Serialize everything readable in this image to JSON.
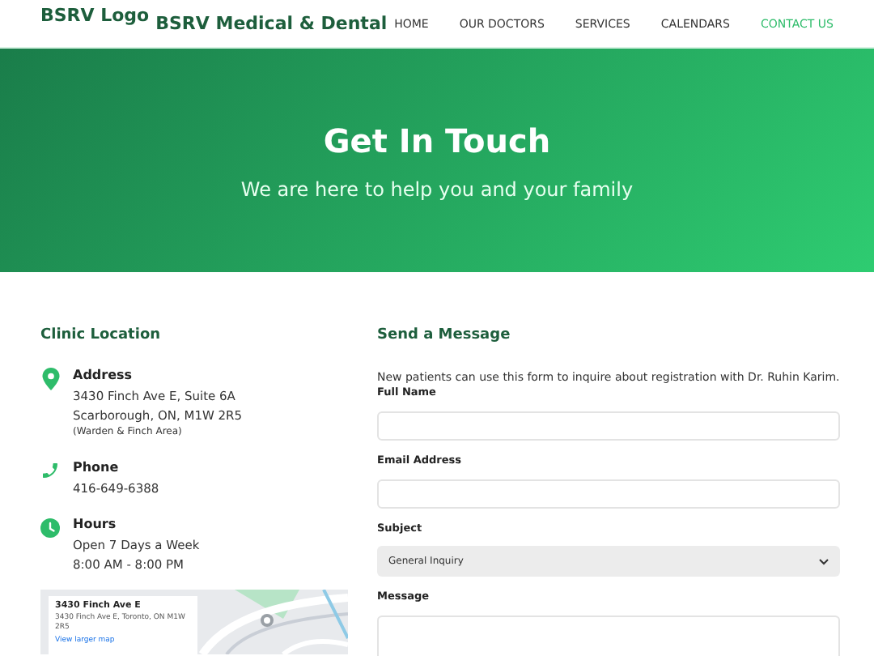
{
  "header": {
    "logo_alt": "BSRV Logo",
    "brand": "BSRV Medical & Dental",
    "nav": [
      {
        "label": "HOME",
        "selected": false
      },
      {
        "label": "OUR DOCTORS",
        "selected": false
      },
      {
        "label": "SERVICES",
        "selected": false
      },
      {
        "label": "CALENDARS",
        "selected": false
      },
      {
        "label": "CONTACT US",
        "selected": true
      }
    ]
  },
  "hero": {
    "title": "Get In Touch",
    "subtitle": "We are here to help you and your family"
  },
  "location": {
    "heading": "Clinic Location",
    "items": [
      {
        "kind": "pin",
        "title": "Address",
        "lines": [
          "3430 Finch Ave E, Suite 6A",
          "Scarborough, ON, M1W 2R5"
        ],
        "note": "(Warden & Finch Area)"
      },
      {
        "kind": "phone",
        "title": "Phone",
        "lines": [
          "416-649-6388"
        ]
      },
      {
        "kind": "clock",
        "title": "Hours",
        "lines": [
          "Open 7 Days a Week",
          "8:00 AM - 8:00 PM"
        ]
      }
    ],
    "map": {
      "card_title": "3430 Finch Ave E",
      "card_address": "3430 Finch Ave E, Toronto, ON M1W 2R5",
      "card_link": "View larger map"
    }
  },
  "form": {
    "heading": "Send a Message",
    "intro": "New patients can use this form to inquire about registration with Dr. Ruhin Karim.",
    "fields": [
      {
        "kind": "text",
        "label": "Full Name"
      },
      {
        "kind": "text",
        "label": "Email Address"
      },
      {
        "kind": "select",
        "label": "Subject",
        "value": "General Inquiry"
      },
      {
        "kind": "textarea",
        "label": "Message"
      }
    ]
  }
}
